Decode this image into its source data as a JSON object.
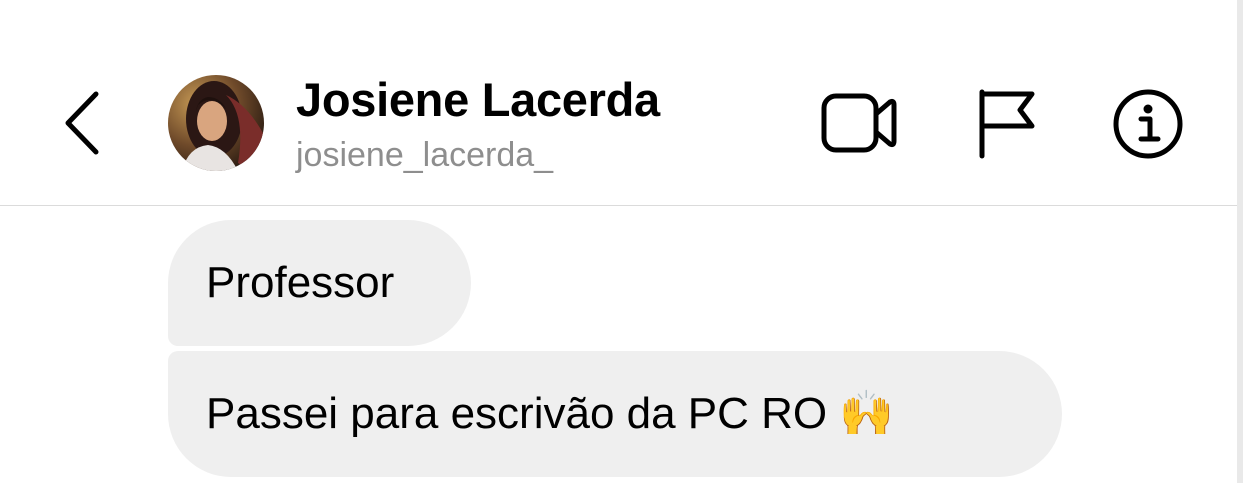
{
  "header": {
    "contact_name": "Josiene Lacerda",
    "contact_handle": "josiene_lacerda_",
    "icons": {
      "back": "chevron-left-icon",
      "video": "video-camera-icon",
      "report": "flag-icon",
      "info": "info-icon"
    }
  },
  "messages": [
    {
      "text": "Professor",
      "sender": "contact"
    },
    {
      "text": "Passei para escrivão da PC RO 🙌",
      "sender": "contact"
    }
  ],
  "colors": {
    "bubble_background": "#efefef",
    "handle_text": "#8e8e8e",
    "divider": "#dbdbdb"
  }
}
